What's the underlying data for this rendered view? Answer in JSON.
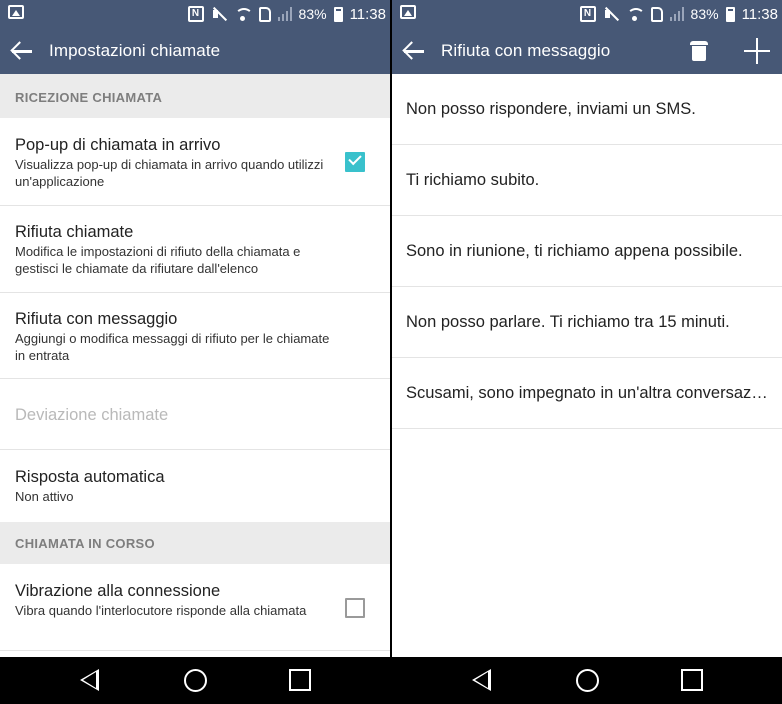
{
  "status_bar": {
    "nfc": "N",
    "battery": "83%",
    "time": "11:38"
  },
  "left_screen": {
    "title": "Impostazioni chiamate",
    "sections": [
      {
        "header": "RICEZIONE CHIAMATA",
        "items": [
          {
            "title": "Pop-up di chiamata in arrivo",
            "subtitle": "Visualizza pop-up di chiamata in arrivo quando utilizzi un'applicazione",
            "checkbox": "checked"
          },
          {
            "title": "Rifiuta chiamate",
            "subtitle": "Modifica le impostazioni di rifiuto della chiamata e gestisci le chiamate da rifiutare dall'elenco"
          },
          {
            "title": "Rifiuta con messaggio",
            "subtitle": "Aggiungi o modifica messaggi di rifiuto per le chiamate in entrata"
          },
          {
            "title": "Deviazione chiamate",
            "disabled": true
          },
          {
            "title": "Risposta automatica",
            "subtitle": "Non attivo"
          }
        ]
      },
      {
        "header": "CHIAMATA IN CORSO",
        "items": [
          {
            "title": "Vibrazione alla connessione",
            "subtitle": "Vibra quando l'interlocutore risponde alla chiamata",
            "checkbox": "unchecked"
          }
        ]
      }
    ]
  },
  "right_screen": {
    "title": "Rifiuta con messaggio",
    "messages": [
      "Non posso rispondere, inviami un SMS.",
      "Ti richiamo subito.",
      "Sono in riunione, ti richiamo appena possibile.",
      "Non posso parlare. Ti richiamo tra 15 minuti.",
      "Scusami, sono impegnato in un'altra conversazione."
    ]
  },
  "icons": {
    "status": [
      "gallery-icon",
      "nfc-icon",
      "mute-icon",
      "wifi-icon",
      "sim-icon",
      "signal-icon",
      "battery-icon"
    ],
    "toolbar": [
      "back-arrow-icon",
      "trash-icon",
      "plus-icon"
    ],
    "nav": [
      "nav-back-icon",
      "nav-home-icon",
      "nav-recent-icon"
    ]
  },
  "colors": {
    "app_bar": "#475876",
    "accent_checkbox": "#39c1cc",
    "section_header_bg": "#ebebeb",
    "section_header_text": "#7e7e7e",
    "disabled_text": "#b9b9b9"
  }
}
